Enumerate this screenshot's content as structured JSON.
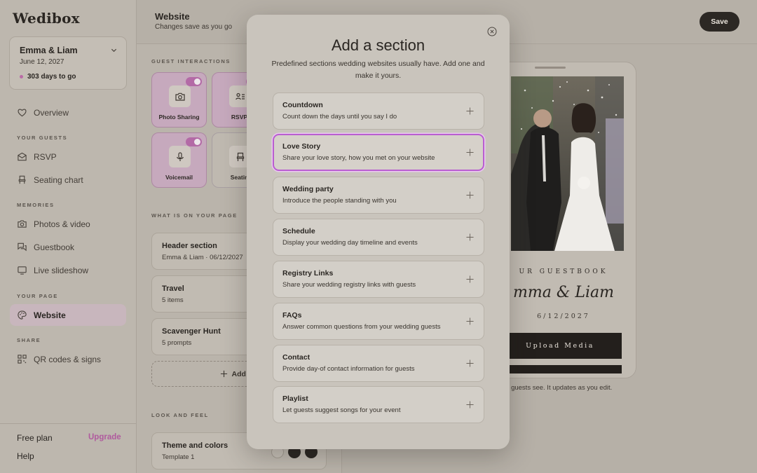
{
  "app": {
    "logo": "Wedibox"
  },
  "event": {
    "name": "Emma & Liam",
    "date": "June 12, 2027",
    "countdown": "303 days to go"
  },
  "sidebar": {
    "overview": "Overview",
    "section_guests": "YOUR GUESTS",
    "rsvp": "RSVP",
    "seating": "Seating chart",
    "section_memories": "MEMORIES",
    "photos": "Photos & video",
    "guestbook": "Guestbook",
    "slideshow": "Live slideshow",
    "section_page": "YOUR PAGE",
    "website": "Website",
    "section_share": "SHARE",
    "qr": "QR codes & signs",
    "plan": "Free plan",
    "upgrade": "Upgrade",
    "help": "Help"
  },
  "header": {
    "title": "Website",
    "subtitle": "Changes save as you go",
    "save": "Save"
  },
  "guest_interactions": {
    "label": "GUEST INTERACTIONS",
    "tiles": [
      {
        "label": "Photo Sharing",
        "on": true
      },
      {
        "label": "RSVP",
        "on": true
      },
      {
        "label": "Voicemail",
        "on": true
      },
      {
        "label": "Seatin",
        "on": false
      }
    ]
  },
  "page_sections": {
    "label": "WHAT IS ON YOUR PAGE",
    "cards": [
      {
        "title": "Header section",
        "sub": "Emma & Liam · 06/12/2027"
      },
      {
        "title": "Travel",
        "sub": "5 items"
      },
      {
        "title": "Scavenger Hunt",
        "sub": "5 prompts"
      }
    ],
    "add": "Add a s"
  },
  "look": {
    "label": "LOOK AND FEEL",
    "title": "Theme and colors",
    "sub": "Template 1"
  },
  "preview": {
    "guestbook": "UR GUESTBOOK",
    "couple": "mma & Liam",
    "date": "6/12/2027",
    "upload": "Upload Media",
    "note": "ur guests see. It updates as you edit."
  },
  "modal": {
    "title": "Add a section",
    "description": "Predefined sections wedding websites usually have. Add one and make it yours.",
    "options": [
      {
        "title": "Countdown",
        "desc": "Count down the days until you say I do"
      },
      {
        "title": "Love Story",
        "desc": "Share your love story, how you met on your website",
        "selected": true
      },
      {
        "title": "Wedding party",
        "desc": "Introduce the people standing with you"
      },
      {
        "title": "Schedule",
        "desc": "Display your wedding day timeline and events"
      },
      {
        "title": "Registry Links",
        "desc": "Share your wedding registry links with guests"
      },
      {
        "title": "FAQs",
        "desc": "Answer common questions from your wedding guests"
      },
      {
        "title": "Contact",
        "desc": "Provide day-of contact information for guests"
      },
      {
        "title": "Playlist",
        "desc": "Let guests suggest songs for your event"
      }
    ]
  },
  "colors": {
    "accent": "#b95ed0",
    "brand_pink": "#b05a9e",
    "dark": "#2c2824"
  }
}
